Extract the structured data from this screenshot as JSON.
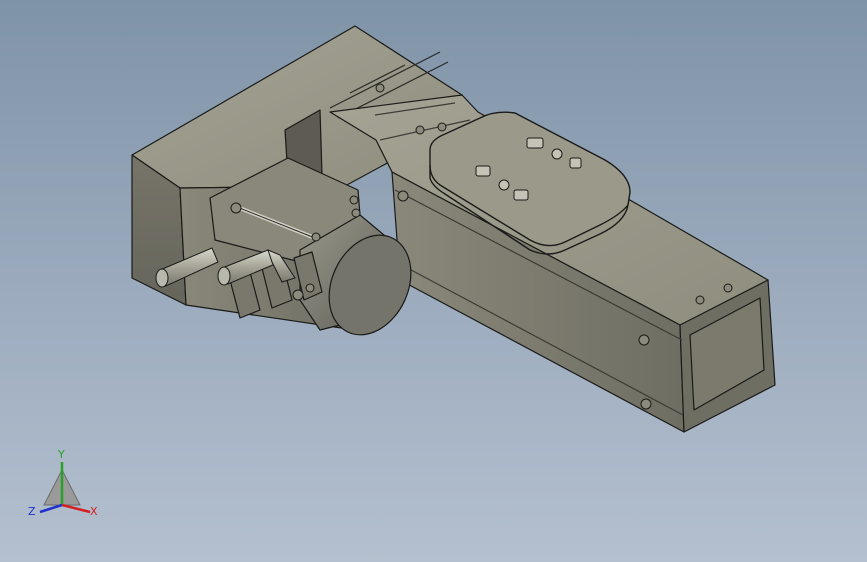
{
  "viewport": {
    "background_top": "#7f93a7",
    "background_bottom": "#b4c0cf",
    "model_body_color": "#7d7b6c",
    "model_edge_color": "#1a1a18"
  },
  "triad": {
    "x_label": "X",
    "y_label": "Y",
    "z_label": "Z",
    "x_color": "#d42020",
    "y_color": "#2aa02a",
    "z_color": "#2030c8"
  },
  "carriage_icons": [
    "cable-connector-icon",
    "drive-switch-icon",
    "port-icon"
  ]
}
